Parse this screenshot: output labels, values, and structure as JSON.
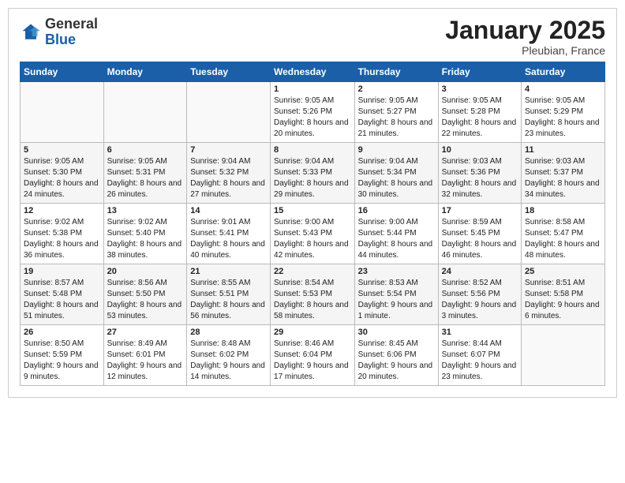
{
  "header": {
    "logo_line1": "General",
    "logo_line2": "Blue",
    "month": "January 2025",
    "location": "Pleubian, France"
  },
  "weekdays": [
    "Sunday",
    "Monday",
    "Tuesday",
    "Wednesday",
    "Thursday",
    "Friday",
    "Saturday"
  ],
  "weeks": [
    [
      {
        "day": "",
        "info": ""
      },
      {
        "day": "",
        "info": ""
      },
      {
        "day": "",
        "info": ""
      },
      {
        "day": "1",
        "info": "Sunrise: 9:05 AM\nSunset: 5:26 PM\nDaylight: 8 hours\nand 20 minutes."
      },
      {
        "day": "2",
        "info": "Sunrise: 9:05 AM\nSunset: 5:27 PM\nDaylight: 8 hours\nand 21 minutes."
      },
      {
        "day": "3",
        "info": "Sunrise: 9:05 AM\nSunset: 5:28 PM\nDaylight: 8 hours\nand 22 minutes."
      },
      {
        "day": "4",
        "info": "Sunrise: 9:05 AM\nSunset: 5:29 PM\nDaylight: 8 hours\nand 23 minutes."
      }
    ],
    [
      {
        "day": "5",
        "info": "Sunrise: 9:05 AM\nSunset: 5:30 PM\nDaylight: 8 hours\nand 24 minutes."
      },
      {
        "day": "6",
        "info": "Sunrise: 9:05 AM\nSunset: 5:31 PM\nDaylight: 8 hours\nand 26 minutes."
      },
      {
        "day": "7",
        "info": "Sunrise: 9:04 AM\nSunset: 5:32 PM\nDaylight: 8 hours\nand 27 minutes."
      },
      {
        "day": "8",
        "info": "Sunrise: 9:04 AM\nSunset: 5:33 PM\nDaylight: 8 hours\nand 29 minutes."
      },
      {
        "day": "9",
        "info": "Sunrise: 9:04 AM\nSunset: 5:34 PM\nDaylight: 8 hours\nand 30 minutes."
      },
      {
        "day": "10",
        "info": "Sunrise: 9:03 AM\nSunset: 5:36 PM\nDaylight: 8 hours\nand 32 minutes."
      },
      {
        "day": "11",
        "info": "Sunrise: 9:03 AM\nSunset: 5:37 PM\nDaylight: 8 hours\nand 34 minutes."
      }
    ],
    [
      {
        "day": "12",
        "info": "Sunrise: 9:02 AM\nSunset: 5:38 PM\nDaylight: 8 hours\nand 36 minutes."
      },
      {
        "day": "13",
        "info": "Sunrise: 9:02 AM\nSunset: 5:40 PM\nDaylight: 8 hours\nand 38 minutes."
      },
      {
        "day": "14",
        "info": "Sunrise: 9:01 AM\nSunset: 5:41 PM\nDaylight: 8 hours\nand 40 minutes."
      },
      {
        "day": "15",
        "info": "Sunrise: 9:00 AM\nSunset: 5:43 PM\nDaylight: 8 hours\nand 42 minutes."
      },
      {
        "day": "16",
        "info": "Sunrise: 9:00 AM\nSunset: 5:44 PM\nDaylight: 8 hours\nand 44 minutes."
      },
      {
        "day": "17",
        "info": "Sunrise: 8:59 AM\nSunset: 5:45 PM\nDaylight: 8 hours\nand 46 minutes."
      },
      {
        "day": "18",
        "info": "Sunrise: 8:58 AM\nSunset: 5:47 PM\nDaylight: 8 hours\nand 48 minutes."
      }
    ],
    [
      {
        "day": "19",
        "info": "Sunrise: 8:57 AM\nSunset: 5:48 PM\nDaylight: 8 hours\nand 51 minutes."
      },
      {
        "day": "20",
        "info": "Sunrise: 8:56 AM\nSunset: 5:50 PM\nDaylight: 8 hours\nand 53 minutes."
      },
      {
        "day": "21",
        "info": "Sunrise: 8:55 AM\nSunset: 5:51 PM\nDaylight: 8 hours\nand 56 minutes."
      },
      {
        "day": "22",
        "info": "Sunrise: 8:54 AM\nSunset: 5:53 PM\nDaylight: 8 hours\nand 58 minutes."
      },
      {
        "day": "23",
        "info": "Sunrise: 8:53 AM\nSunset: 5:54 PM\nDaylight: 9 hours\nand 1 minute."
      },
      {
        "day": "24",
        "info": "Sunrise: 8:52 AM\nSunset: 5:56 PM\nDaylight: 9 hours\nand 3 minutes."
      },
      {
        "day": "25",
        "info": "Sunrise: 8:51 AM\nSunset: 5:58 PM\nDaylight: 9 hours\nand 6 minutes."
      }
    ],
    [
      {
        "day": "26",
        "info": "Sunrise: 8:50 AM\nSunset: 5:59 PM\nDaylight: 9 hours\nand 9 minutes."
      },
      {
        "day": "27",
        "info": "Sunrise: 8:49 AM\nSunset: 6:01 PM\nDaylight: 9 hours\nand 12 minutes."
      },
      {
        "day": "28",
        "info": "Sunrise: 8:48 AM\nSunset: 6:02 PM\nDaylight: 9 hours\nand 14 minutes."
      },
      {
        "day": "29",
        "info": "Sunrise: 8:46 AM\nSunset: 6:04 PM\nDaylight: 9 hours\nand 17 minutes."
      },
      {
        "day": "30",
        "info": "Sunrise: 8:45 AM\nSunset: 6:06 PM\nDaylight: 9 hours\nand 20 minutes."
      },
      {
        "day": "31",
        "info": "Sunrise: 8:44 AM\nSunset: 6:07 PM\nDaylight: 9 hours\nand 23 minutes."
      },
      {
        "day": "",
        "info": ""
      }
    ]
  ]
}
